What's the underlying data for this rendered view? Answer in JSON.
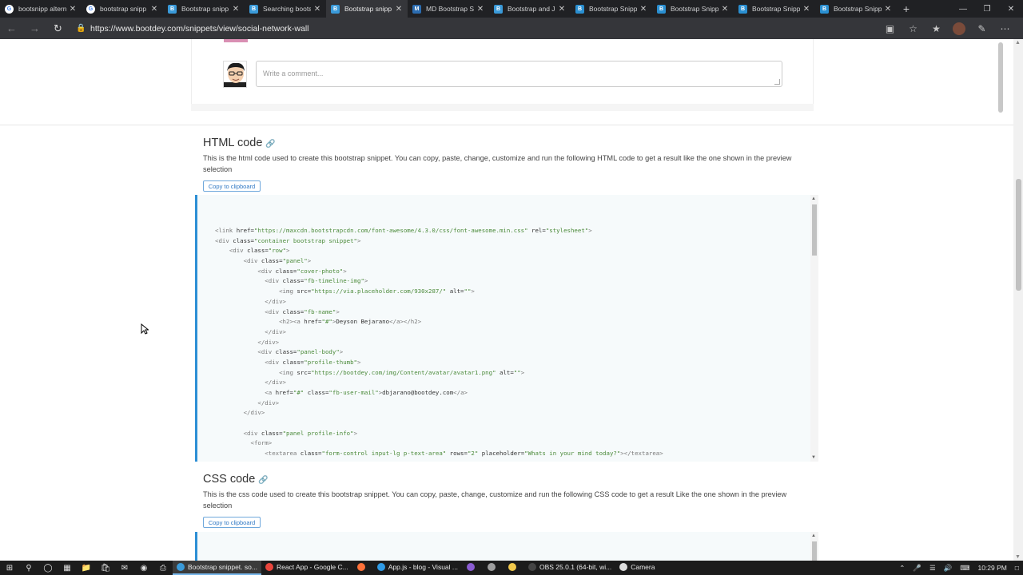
{
  "browser": {
    "tabs": [
      {
        "label": "bootsnipp altern",
        "fav": "G",
        "favclass": "g"
      },
      {
        "label": "bootstrap snipp",
        "fav": "G",
        "favclass": "g"
      },
      {
        "label": "Bootstrap snipp",
        "fav": "B",
        "favclass": "bs"
      },
      {
        "label": "Searching boots",
        "fav": "B",
        "favclass": "bs"
      },
      {
        "label": "Bootstrap snipp",
        "fav": "B",
        "favclass": "bs",
        "active": true
      },
      {
        "label": "MD Bootstrap S",
        "fav": "M",
        "favclass": "md"
      },
      {
        "label": "Bootstrap and J",
        "fav": "B",
        "favclass": "ba"
      },
      {
        "label": "Bootstrap Snipp",
        "fav": "B",
        "favclass": "ss"
      },
      {
        "label": "Bootstrap Snipp",
        "fav": "B",
        "favclass": "ss"
      },
      {
        "label": "Bootstrap Snipp",
        "fav": "B",
        "favclass": "ss"
      },
      {
        "label": "Bootstrap Snipp",
        "fav": "B",
        "favclass": "ss"
      }
    ],
    "url": "https://www.bootdey.com/snippets/view/social-network-wall"
  },
  "preview": {
    "comment_placeholder": "Write a comment..."
  },
  "html_section": {
    "title": "HTML code",
    "description": "This is the html code used to create this bootstrap snippet. You can copy, paste, change, customize and run the following HTML code to get a result like the one shown in the preview selection",
    "copy_label": "Copy to clipboard",
    "code_lines": [
      "<link href=\"https://maxcdn.bootstrapcdn.com/font-awesome/4.3.0/css/font-awesome.min.css\" rel=\"stylesheet\">",
      "<div class=\"container bootstrap snippet\">",
      "    <div class=\"row\">",
      "        <div class=\"panel\">",
      "            <div class=\"cover-photo\">",
      "              <div class=\"fb-timeline-img\">",
      "                  <img src=\"https://via.placeholder.com/930x287/\" alt=\"\">",
      "              </div>",
      "              <div class=\"fb-name\">",
      "                  <h2><a href=\"#\">Deyson Bejarano</a></h2>",
      "              </div>",
      "            </div>",
      "            <div class=\"panel-body\">",
      "              <div class=\"profile-thumb\">",
      "                  <img src=\"https://bootdey.com/img/Content/avatar/avatar1.png\" alt=\"\">",
      "              </div>",
      "              <a href=\"#\" class=\"fb-user-mail\">dbjarano@bootdey.com</a>",
      "            </div>",
      "        </div>",
      "",
      "        <div class=\"panel profile-info\">",
      "          <form>",
      "              <textarea class=\"form-control input-lg p-text-area\" rows=\"2\" placeholder=\"Whats in your mind today?\"></textarea>"
    ]
  },
  "css_section": {
    "title": "CSS code",
    "description": "This is the css code used to create this bootstrap snippet. You can copy, paste, change, customize and run the following CSS code to get a result Like the one shown in the preview selection",
    "copy_label": "Copy to clipboard"
  },
  "taskbar": {
    "apps": [
      {
        "label": "Bootstrap snippet. so...",
        "color": "#3a9ad9",
        "active": true
      },
      {
        "label": "React App - Google C...",
        "color": "#e8453c"
      },
      {
        "label": "",
        "color": "#ff7139"
      },
      {
        "label": "App.js - blog - Visual ...",
        "color": "#2f9be6"
      },
      {
        "label": "",
        "color": "#8a5cd1"
      },
      {
        "label": "",
        "color": "#9e9e9e"
      },
      {
        "label": "",
        "color": "#f2c94c"
      },
      {
        "label": "OBS 25.0.1 (64-bit, wi...",
        "color": "#444444"
      },
      {
        "label": "Camera",
        "color": "#dddddd"
      }
    ],
    "clock": "10:29 PM"
  },
  "colors": {
    "accent": "#2d8fd5",
    "chrome_bg": "#202124",
    "toolbar_bg": "#35363a"
  }
}
